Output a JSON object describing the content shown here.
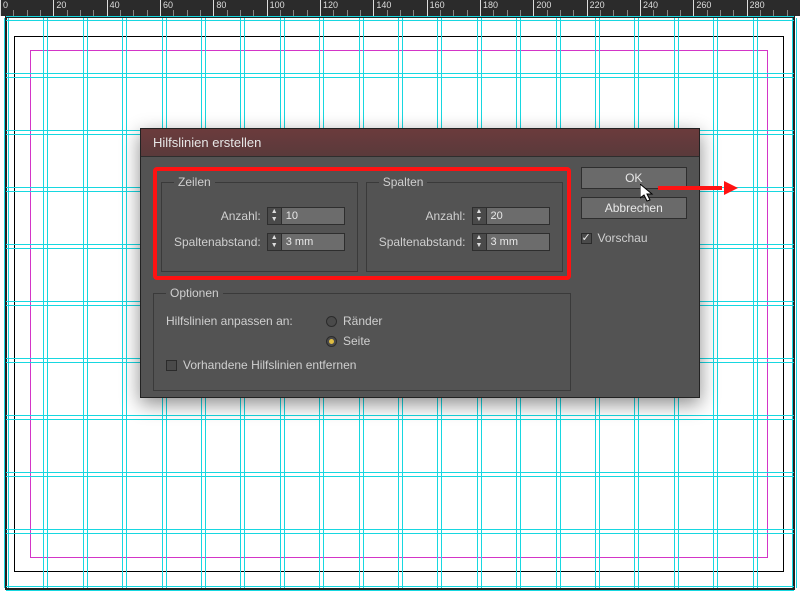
{
  "ruler": {
    "majors": [
      0,
      20,
      40,
      60,
      80,
      100,
      120,
      140,
      160,
      180,
      200,
      220,
      240,
      260,
      280
    ]
  },
  "dialog": {
    "title": "Hilfslinien erstellen",
    "rows_group": {
      "legend": "Zeilen",
      "count_label": "Anzahl:",
      "count_value": "10",
      "gutter_label": "Spaltenabstand:",
      "gutter_value": "3 mm"
    },
    "cols_group": {
      "legend": "Spalten",
      "count_label": "Anzahl:",
      "count_value": "20",
      "gutter_label": "Spaltenabstand:",
      "gutter_value": "3 mm"
    },
    "options": {
      "legend": "Optionen",
      "fit_label": "Hilfslinien anpassen an:",
      "fit_margins": "Ränder",
      "fit_page": "Seite",
      "fit_selected": "page",
      "remove_existing_label": "Vorhandene Hilfslinien entfernen",
      "remove_existing_checked": false
    },
    "buttons": {
      "ok": "OK",
      "cancel": "Abbrechen"
    },
    "preview": {
      "label": "Vorschau",
      "checked": true
    }
  },
  "guides": {
    "v_count": 20,
    "h_count": 10
  }
}
